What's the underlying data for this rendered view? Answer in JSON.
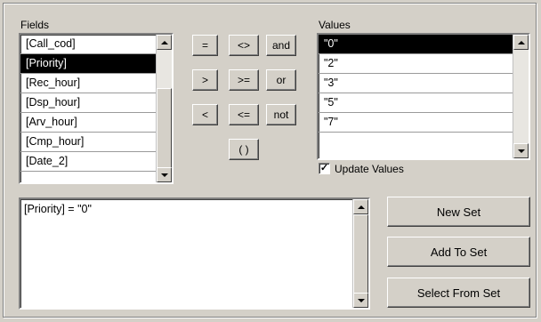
{
  "fields": {
    "label": "Fields",
    "items": [
      "[Call_cod]",
      "[Priority]",
      "[Rec_hour]",
      "[Dsp_hour]",
      "[Arv_hour]",
      "[Cmp_hour]",
      "[Date_2]"
    ],
    "selected_index": 1
  },
  "operators": {
    "eq": "=",
    "ne": "<>",
    "and": "and",
    "gt": ">",
    "ge": ">=",
    "or": "or",
    "lt": "<",
    "le": "<=",
    "not": "not",
    "paren": "( )"
  },
  "values": {
    "label": "Values",
    "items": [
      "\"0\"",
      "\"2\"",
      "\"3\"",
      "\"5\"",
      "\"7\""
    ],
    "selected_index": 0
  },
  "update_values": {
    "label": "Update Values",
    "checked": true,
    "mark": "✓"
  },
  "query": {
    "text": "[Priority] = \"0\""
  },
  "actions": {
    "new_set": "New Set",
    "add_to_set": "Add To Set",
    "select_from_set": "Select From Set"
  },
  "colors": {
    "face": "#d4d0c8",
    "selection": "#000000"
  }
}
